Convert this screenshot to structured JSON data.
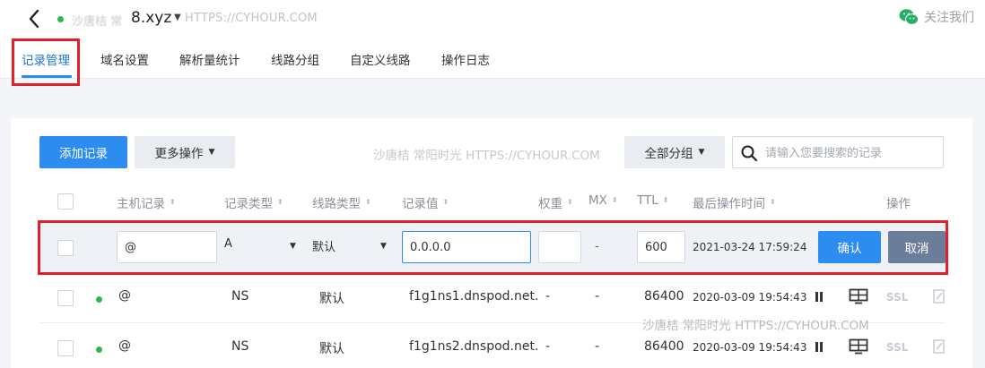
{
  "header": {
    "domain_prefix_blurred": "沙唐桔 常",
    "domain_suffix": "8.xyz",
    "watermark": "HTTPS://CYHOUR.COM",
    "follow_label": "关注我们"
  },
  "tabs": [
    {
      "label": "记录管理",
      "active": true
    },
    {
      "label": "域名设置"
    },
    {
      "label": "解析量统计"
    },
    {
      "label": "线路分组"
    },
    {
      "label": "自定义线路"
    },
    {
      "label": "操作日志"
    }
  ],
  "toolbar": {
    "add_record": "添加记录",
    "more_actions": "更多操作",
    "watermark": "沙唐桔 常阳时光 HTTPS://CYHOUR.COM",
    "all_groups": "全部分组",
    "search_placeholder": "请输入您要搜索的记录"
  },
  "table": {
    "columns": {
      "host": "主机记录",
      "type": "记录类型",
      "line": "线路类型",
      "value": "记录值",
      "weight": "权重",
      "mx": "MX",
      "ttl": "TTL",
      "last_op": "最后操作时间",
      "actions": "操作"
    },
    "edit_row": {
      "host": "@",
      "type": "A",
      "line": "默认",
      "value": "0.0.0.0",
      "weight": "",
      "mx": "-",
      "ttl": "600",
      "time": "2021-03-24 17:59:24",
      "confirm": "确认",
      "cancel": "取消"
    },
    "rows": [
      {
        "host": "@",
        "type": "NS",
        "line": "默认",
        "value": "f1g1ns1.dnspod.net.",
        "weight": "-",
        "mx": "-",
        "ttl": "86400",
        "time": "2020-03-09 19:54:43",
        "ssl": "SSL"
      },
      {
        "host": "@",
        "type": "NS",
        "line": "默认",
        "value": "f1g1ns2.dnspod.net.",
        "weight": "-",
        "mx": "-",
        "ttl": "86400",
        "time": "2020-03-09 19:54:43",
        "ssl": "SSL"
      }
    ]
  },
  "watermark_row": "沙唐桔 常阳时光 HTTPS://CYHOUR.COM",
  "colors": {
    "primary": "#2d8cf0",
    "active_tab": "#1d75d6",
    "status_green": "#2db84d",
    "highlight_red": "#e0202a",
    "cancel_gray": "#6c7d99"
  }
}
